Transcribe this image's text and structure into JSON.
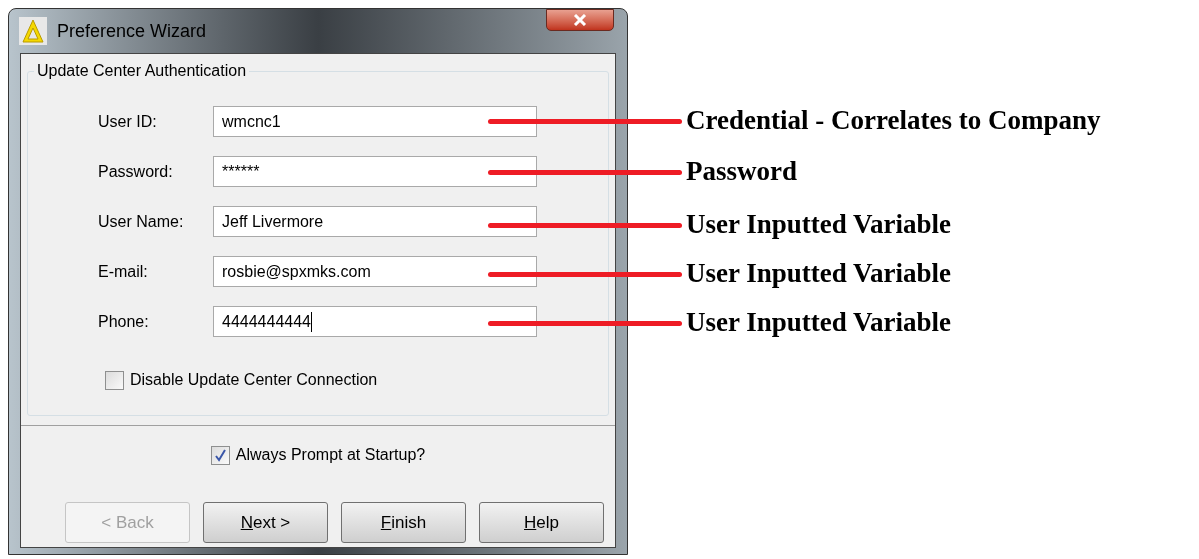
{
  "window": {
    "title": "Preference Wizard"
  },
  "group": {
    "title": "Update Center Authentication"
  },
  "fields": [
    {
      "label": "User ID:",
      "value": "wmcnc1",
      "focused": false
    },
    {
      "label": "Password:",
      "value": "******",
      "focused": false
    },
    {
      "label": "User Name:",
      "value": "Jeff Livermore",
      "focused": false
    },
    {
      "label": "E-mail:",
      "value": "rosbie@spxmks.com",
      "focused": false
    },
    {
      "label": "Phone:",
      "value": "4444444444",
      "focused": true
    }
  ],
  "disable_connection": {
    "label": "Disable Update Center Connection",
    "checked": false
  },
  "always_prompt": {
    "label": "Always Prompt at Startup?",
    "checked": true
  },
  "buttons": [
    {
      "label": "< Back",
      "disabled": true,
      "mnemonic": false
    },
    {
      "label": "Next >",
      "disabled": false,
      "mnemonic": true
    },
    {
      "label": "Finish",
      "disabled": false,
      "mnemonic": true
    },
    {
      "label": "Help",
      "disabled": false,
      "mnemonic": true
    }
  ],
  "annotations": [
    {
      "text": "Credential - Correlates to Company"
    },
    {
      "text": "Password"
    },
    {
      "text": "User Inputted Variable"
    },
    {
      "text": "User Inputted Variable"
    },
    {
      "text": "User Inputted Variable"
    }
  ]
}
